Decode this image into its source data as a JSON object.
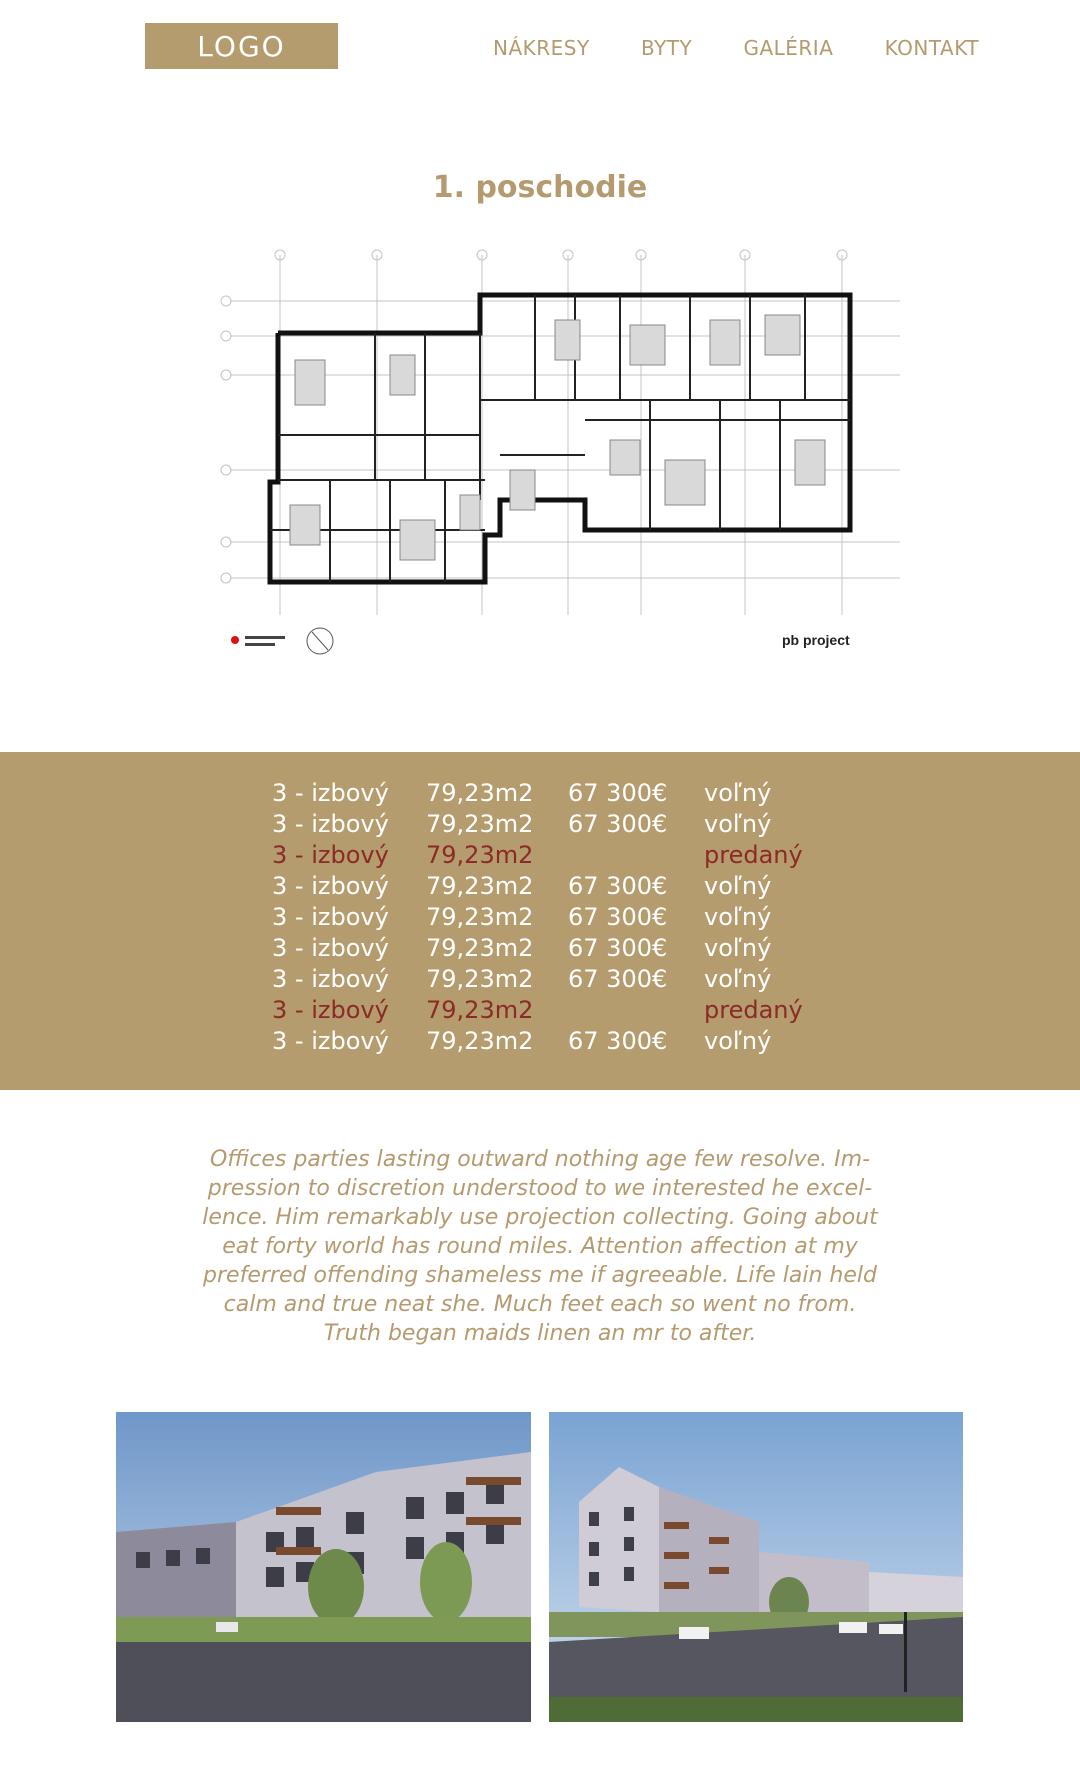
{
  "header": {
    "logo": "LOGO",
    "nav": [
      "NÁKRESY",
      "BYTY",
      "GALÉRIA",
      "KONTAKT"
    ]
  },
  "floor": {
    "title": "1. poschodie",
    "plan_credit": "pb project"
  },
  "apartments": [
    {
      "type": "3 - izbový",
      "area": "79,23m2",
      "price": "67 300€",
      "status": "voľný",
      "sold": false
    },
    {
      "type": "3 - izbový",
      "area": "79,23m2",
      "price": "67 300€",
      "status": "voľný",
      "sold": false
    },
    {
      "type": "3 - izbový",
      "area": "79,23m2",
      "price": "",
      "status": "predaný",
      "sold": true
    },
    {
      "type": "3 - izbový",
      "area": "79,23m2",
      "price": "67 300€",
      "status": "voľný",
      "sold": false
    },
    {
      "type": "3 - izbový",
      "area": "79,23m2",
      "price": "67 300€",
      "status": "voľný",
      "sold": false
    },
    {
      "type": "3 - izbový",
      "area": "79,23m2",
      "price": "67 300€",
      "status": "voľný",
      "sold": false
    },
    {
      "type": "3 - izbový",
      "area": "79,23m2",
      "price": "67 300€",
      "status": "voľný",
      "sold": false
    },
    {
      "type": "3 - izbový",
      "area": "79,23m2",
      "price": "",
      "status": "predaný",
      "sold": true
    },
    {
      "type": "3 - izbový",
      "area": "79,23m2",
      "price": "67 300€",
      "status": "voľný",
      "sold": false
    }
  ],
  "description": {
    "lines": [
      "Offices parties lasting outward nothing age few resolve. Im-",
      "pression to discretion understood to we interested he excel-",
      "lence. Him remarkably use projection collecting. Going about",
      "eat forty world has round miles. Attention affection at my",
      "preferred offending shameless me if agreeable. Life lain held",
      "calm and true neat she. Much feet each so went no from.",
      "Truth began maids linen an mr to after."
    ]
  },
  "colors": {
    "accent": "#b59c6f",
    "sold": "#8b2a26",
    "text_on_accent": "#ffffff"
  }
}
